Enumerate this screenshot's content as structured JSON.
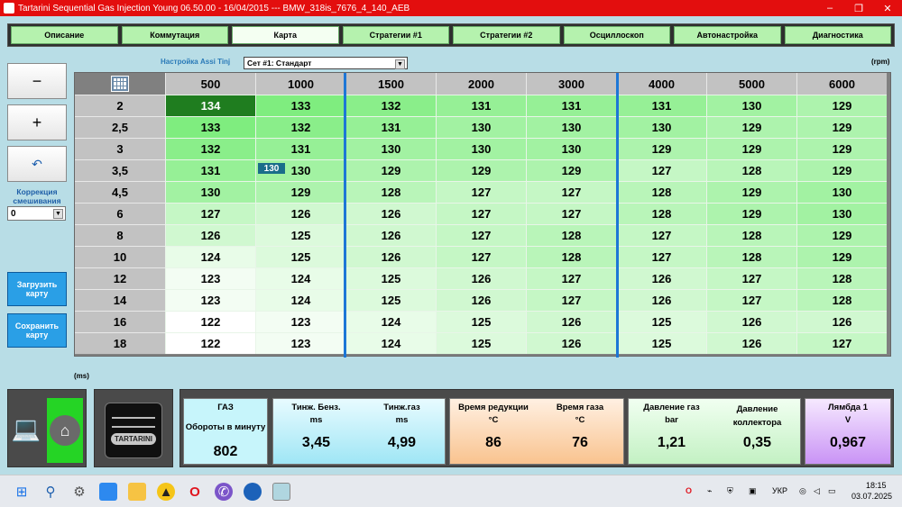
{
  "window": {
    "title": "Tartarini Sequential Gas Injection Young 06.50.00 - 16/04/2015 --- BMW_318is_7676_4_140_AEB",
    "minimize": "–",
    "maximize": "❐",
    "close": "✕"
  },
  "tabs": [
    {
      "label": "Описание"
    },
    {
      "label": "Коммутация"
    },
    {
      "label": "Карта",
      "active": true
    },
    {
      "label": "Стратегии #1"
    },
    {
      "label": "Стратегии #2"
    },
    {
      "label": "Осциллоскоп"
    },
    {
      "label": "Автонастройка"
    },
    {
      "label": "Диагностика"
    }
  ],
  "left": {
    "minus": "−",
    "plus": "+",
    "undo": "↶",
    "correction_label": "Коррекция смешивания",
    "correction_value": "0",
    "load_map": "Загрузить карту",
    "save_map": "Сохранить карту"
  },
  "map": {
    "setting_label": "Настройка Assi Tinj",
    "set_select": "Сет #1: Стандарт",
    "rpm_unit": "(rpm)",
    "ms_unit": "(ms)",
    "cursor_value": "130",
    "columns": [
      "500",
      "1000",
      "1500",
      "2000",
      "3000",
      "4000",
      "5000",
      "6000"
    ],
    "rows": [
      {
        "label": "2",
        "values": [
          "134",
          "133",
          "132",
          "131",
          "131",
          "131",
          "130",
          "129"
        ]
      },
      {
        "label": "2,5",
        "values": [
          "133",
          "132",
          "131",
          "130",
          "130",
          "130",
          "129",
          "129"
        ]
      },
      {
        "label": "3",
        "values": [
          "132",
          "131",
          "130",
          "130",
          "130",
          "129",
          "129",
          "129"
        ]
      },
      {
        "label": "3,5",
        "values": [
          "131",
          "130",
          "129",
          "129",
          "129",
          "127",
          "128",
          "129"
        ]
      },
      {
        "label": "4,5",
        "values": [
          "130",
          "129",
          "128",
          "127",
          "127",
          "128",
          "129",
          "130"
        ]
      },
      {
        "label": "6",
        "values": [
          "127",
          "126",
          "126",
          "127",
          "127",
          "128",
          "129",
          "130"
        ]
      },
      {
        "label": "8",
        "values": [
          "126",
          "125",
          "126",
          "127",
          "128",
          "127",
          "128",
          "129"
        ]
      },
      {
        "label": "10",
        "values": [
          "124",
          "125",
          "126",
          "127",
          "128",
          "127",
          "128",
          "129"
        ]
      },
      {
        "label": "12",
        "values": [
          "123",
          "124",
          "125",
          "126",
          "127",
          "126",
          "127",
          "128"
        ]
      },
      {
        "label": "14",
        "values": [
          "123",
          "124",
          "125",
          "126",
          "127",
          "126",
          "127",
          "128"
        ]
      },
      {
        "label": "16",
        "values": [
          "122",
          "123",
          "124",
          "125",
          "126",
          "125",
          "126",
          "126"
        ]
      },
      {
        "label": "18",
        "values": [
          "122",
          "123",
          "124",
          "125",
          "126",
          "125",
          "126",
          "127"
        ]
      }
    ]
  },
  "status": {
    "gas": {
      "title": "ГАЗ",
      "rpm_label": "Обороты в минуту",
      "rpm": "802"
    },
    "tinj_benz": {
      "label": "Тинж. Бенз.",
      "unit": "ms",
      "value": "3,45"
    },
    "tinj_gas": {
      "label": "Тинж.газ",
      "unit": "ms",
      "value": "4,99"
    },
    "reducer_temp": {
      "label": "Время редукции",
      "unit": "°C",
      "value": "86"
    },
    "gas_temp": {
      "label": "Время газа",
      "unit": "°C",
      "value": "76"
    },
    "gas_pressure": {
      "label": "Давление газ",
      "unit": "bar",
      "value": "1,21"
    },
    "manifold": {
      "label": "Давление коллектора",
      "value": "0,35"
    },
    "lambda": {
      "label": "Лямбда 1",
      "unit": "V",
      "value": "0,967"
    }
  },
  "device_brand": "TARTARINI",
  "taskbar": {
    "lang": "УКР",
    "time": "18:15",
    "date": "03.07.2025"
  }
}
